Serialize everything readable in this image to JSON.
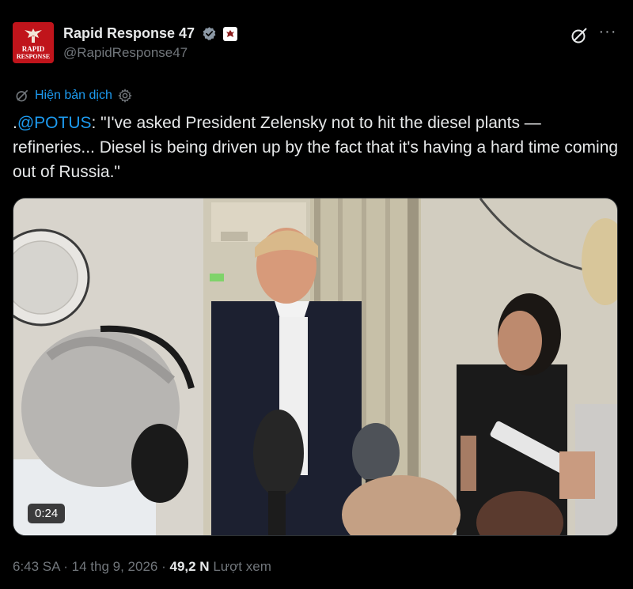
{
  "avatar": {
    "line1": "RAPID",
    "line2": "RESPONSE"
  },
  "author": {
    "display_name": "Rapid Response 47",
    "handle": "@RapidResponse47"
  },
  "translate_label": "Hiện bản dịch",
  "tweet": {
    "prefix": ".",
    "mention": "@POTUS",
    "body": ": \"I've asked President Zelensky not to hit the diesel plants — refineries... Diesel is being driven up by the fact that it's having a hard time coming out of Russia.\""
  },
  "video": {
    "duration": "0:24"
  },
  "meta": {
    "time": "6:43 SA",
    "sep1": " · ",
    "date": "14 thg 9, 2026",
    "sep2": " · ",
    "views_count": "49,2 N",
    "views_label": " Lượt xem"
  },
  "colors": {
    "accent": "#1d9bf0",
    "avatar_bg": "#c0141b",
    "text_primary": "#e7e9ea",
    "text_secondary": "#71767b"
  },
  "icons": {
    "verified": "verified-badge-icon",
    "affiliate": "affiliate-badge-icon",
    "grok": "grok-icon",
    "more": "more-icon",
    "translate": "translate-icon",
    "settings": "gear-icon"
  }
}
